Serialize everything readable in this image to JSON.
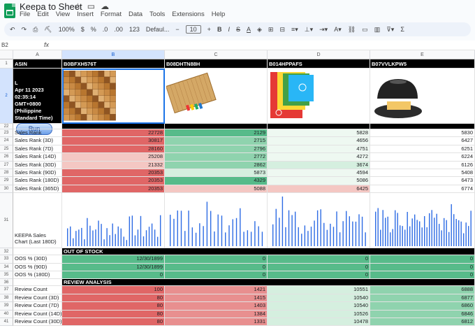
{
  "app": {
    "title": "Keepa to Sheet"
  },
  "menu": [
    "File",
    "Edit",
    "View",
    "Insert",
    "Format",
    "Data",
    "Tools",
    "Extensions",
    "Help"
  ],
  "toolbar": {
    "zoom": "100%",
    "currency": "$",
    "percent": "%",
    "dec_dec": ".0",
    "dec_inc": ".00",
    "format_123": "123",
    "font": "Defaul...",
    "font_size": "10",
    "bold": "B",
    "italic": "I",
    "strike": "S",
    "text_color": "A",
    "sum": "Σ"
  },
  "formula_bar": {
    "cell_ref": "B2",
    "fx": "fx",
    "value": ""
  },
  "columns": [
    "A",
    "B",
    "C",
    "D",
    "E"
  ],
  "header_row": {
    "a": "ASIN",
    "b": "B0BFXH576T",
    "c": "B08DHTN88H",
    "d": "B014HPPAFS",
    "e": "B07VVLKPW5"
  },
  "row2": {
    "run_label": "Run",
    "date_lines": [
      "Apr 11 2023",
      "02:35:14",
      "GMT+0800",
      "(Philippine",
      "Standard Time)"
    ],
    "date_partial": "L"
  },
  "sales_rank": {
    "rows": [
      {
        "num": "23",
        "label": "Sales Rank",
        "vals": [
          "22728",
          "2129",
          "5828",
          "5830"
        ]
      },
      {
        "num": "24",
        "label": "Sales Rank (3D)",
        "vals": [
          "30817",
          "2715",
          "4656",
          "6427"
        ]
      },
      {
        "num": "25",
        "label": "Sales Rank (7D)",
        "vals": [
          "28160",
          "2796",
          "4751",
          "6251"
        ]
      },
      {
        "num": "26",
        "label": "Sales Rank (14D)",
        "vals": [
          "25208",
          "2772",
          "4272",
          "6224"
        ]
      },
      {
        "num": "27",
        "label": "Sales Rank (30D)",
        "vals": [
          "21332",
          "2862",
          "3674",
          "6126"
        ]
      },
      {
        "num": "28",
        "label": "Sales Rank (90D)",
        "vals": [
          "20353",
          "5873",
          "4594",
          "5408"
        ]
      },
      {
        "num": "29",
        "label": "Sales Rank (180D)",
        "vals": [
          "20353",
          "4329",
          "5086",
          "6473"
        ]
      },
      {
        "num": "30",
        "label": "Sales Rank (365D)",
        "vals": [
          "20353",
          "5088",
          "6425",
          "6774"
        ]
      }
    ]
  },
  "chart_row": {
    "num": "31",
    "label": "KEEPA Sales Chart (Last 180D)"
  },
  "out_of_stock": {
    "num": "32",
    "title": "OUT OF STOCK",
    "rows": [
      {
        "num": "33",
        "label": "OOS % (30D)",
        "vals": [
          "12/30/1899",
          "0",
          "0",
          "0"
        ]
      },
      {
        "num": "34",
        "label": "OOS % (90D)",
        "vals": [
          "12/30/1899",
          "0",
          "0",
          "0"
        ]
      },
      {
        "num": "35",
        "label": "OOS % (180D)",
        "vals": [
          "0",
          "0",
          "0",
          "0"
        ]
      }
    ]
  },
  "review": {
    "num": "36",
    "title": "REVIEW ANALYSIS",
    "rows": [
      {
        "num": "37",
        "label": "Review Count",
        "vals": [
          "100",
          "1421",
          "10551",
          "6888"
        ]
      },
      {
        "num": "38",
        "label": "Review Count (3D)",
        "vals": [
          "80",
          "1415",
          "10540",
          "6877"
        ]
      },
      {
        "num": "39",
        "label": "Review Count (7D)",
        "vals": [
          "80",
          "1403",
          "10540",
          "6860"
        ]
      },
      {
        "num": "40",
        "label": "Review Count (14D)",
        "vals": [
          "80",
          "1384",
          "10526",
          "6846"
        ]
      },
      {
        "num": "41",
        "label": "Review Count (30D)",
        "vals": [
          "80",
          "1331",
          "10478",
          "6812"
        ]
      }
    ]
  },
  "row_nums": {
    "r1": "1",
    "r2": "2",
    "r22": "22"
  },
  "colors": {
    "red_strong": "#e06666",
    "red_mid": "#e88f8f",
    "red_light": "#f4c7c3",
    "green_strong": "#57bb8a",
    "green_mid": "#8fd3ae",
    "green_light": "#d5efdf",
    "green_pale": "#eef8f1",
    "chart_bar": "#2d6be4"
  }
}
